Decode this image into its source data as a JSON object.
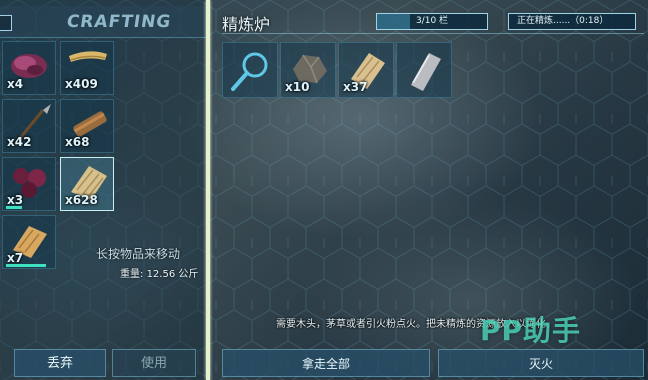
{
  "crafting_panel": {
    "title": "CRAFTING",
    "inventory": [
      {
        "item": "meat",
        "count": "x4"
      },
      {
        "item": "thatch",
        "count": "x409"
      },
      {
        "item": "spear",
        "count": "x42"
      },
      {
        "item": "wood",
        "count": "x68"
      },
      {
        "item": "berries",
        "count": "x3"
      },
      {
        "item": "thatch-bundle",
        "count": "x628"
      },
      {
        "item": "cooked-meat",
        "count": "x7"
      }
    ],
    "move_hint": "长按物品来移动",
    "weight_label": "重量:",
    "weight_value": "12.56 公斤",
    "drop_label": "丢弃",
    "use_label": "使用"
  },
  "forge_panel": {
    "title": "精炼炉",
    "capacity": "3/10 栏",
    "capacity_fraction": 0.3,
    "status": "正在精炼......（0:18）",
    "slots": [
      {
        "item": "search",
        "count": ""
      },
      {
        "item": "metal-ore",
        "count": "x10"
      },
      {
        "item": "wood",
        "count": "x37"
      },
      {
        "item": "metal-ingot",
        "count": ""
      }
    ],
    "hint": "需要木头，茅草或者引火粉点火。把未精炼的资源放入以炼化。",
    "take_all_label": "拿走全部",
    "extinguish_label": "灭火"
  },
  "watermark": "PP助手",
  "colors": {
    "accent": "#3fe0c0",
    "divider": "#e6f2c8",
    "border": "#9fd3e6"
  }
}
